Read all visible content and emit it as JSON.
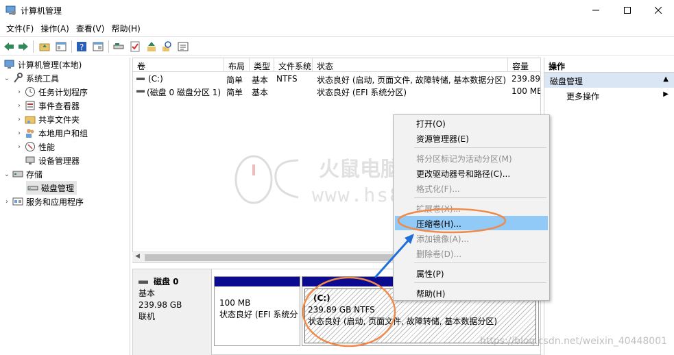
{
  "window": {
    "title": "计算机管理"
  },
  "menubar": [
    "文件(F)",
    "操作(A)",
    "查看(V)",
    "帮助(H)"
  ],
  "tree": {
    "root": "计算机管理(本地)",
    "system_tools": "系统工具",
    "task_scheduler": "任务计划程序",
    "event_viewer": "事件查看器",
    "shared_folders": "共享文件夹",
    "local_users": "本地用户和组",
    "performance": "性能",
    "device_manager": "设备管理器",
    "storage": "存储",
    "disk_management": "磁盘管理",
    "services": "服务和应用程序"
  },
  "table": {
    "headers": [
      "卷",
      "布局",
      "类型",
      "文件系统",
      "状态",
      "容量"
    ],
    "rows": [
      [
        "(C:)",
        "简单",
        "基本",
        "NTFS",
        "状态良好 (启动, 页面文件, 故障转储, 基本数据分区)",
        "239.89"
      ],
      [
        "(磁盘 0 磁盘分区 1)",
        "简单",
        "基本",
        "",
        "状态良好 (EFI 系统分区)",
        "100 ME"
      ]
    ]
  },
  "disk": {
    "name": "磁盘 0",
    "type": "基本",
    "size": "239.98 GB",
    "status": "联机",
    "partitions": [
      {
        "title": "",
        "size": "100 MB",
        "status": "状态良好 (EFI 系统分区"
      },
      {
        "title": "(C:)",
        "size": "239.89 GB NTFS",
        "status": "状态良好 (启动, 页面文件, 故障转储, 基本数据分区)"
      }
    ]
  },
  "actions": {
    "header": "操作",
    "section": "磁盘管理",
    "more": "更多操作"
  },
  "context_menu": {
    "open": "打开(O)",
    "explorer": "资源管理器(E)",
    "mark_active": "将分区标记为活动分区(M)",
    "change_letter": "更改驱动器号和路径(C)...",
    "format": "格式化(F)...",
    "extend": "扩展卷(X)...",
    "shrink": "压缩卷(H)...",
    "add_mirror": "添加镜像(A)...",
    "delete": "删除卷(D)...",
    "properties": "属性(P)",
    "help": "帮助(H)"
  },
  "watermark": {
    "brand": "火鼠电脑",
    "site": "www.hs89.cn",
    "blog": "https://blog.csdn.net/weixin_40448001"
  },
  "colors": {
    "partition_bar": "#0b0b8f",
    "highlight": "#91c9f7",
    "annotation": "#f08a4b",
    "arrow": "#1e6fd9"
  }
}
